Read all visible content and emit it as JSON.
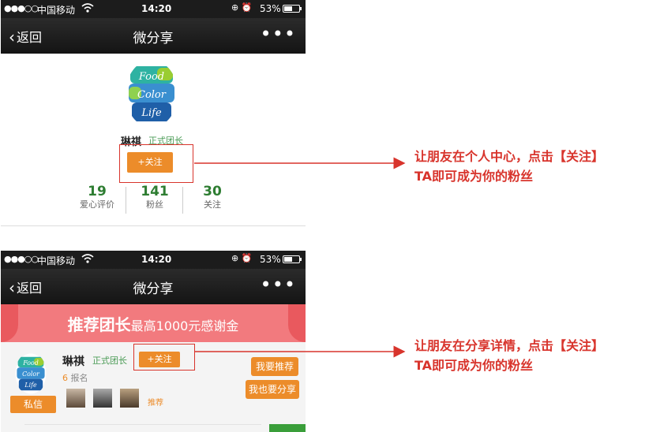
{
  "status_bar": {
    "signal": "●●●○○",
    "carrier": "中国移动",
    "wifi_icon": "wifi-icon",
    "time": "14:20",
    "icons": "⊕ ⏰",
    "battery_percent": "53%",
    "battery_level": 0.53
  },
  "nav": {
    "back_label": "返回",
    "title": "微分享",
    "more": "•••"
  },
  "profile": {
    "logo_text": [
      "Food",
      "Color",
      "Life"
    ],
    "name": "琳祺",
    "role": "正式团长",
    "follow_label": "+关注",
    "stats": [
      {
        "value": "19",
        "label": "爱心评价"
      },
      {
        "value": "141",
        "label": "粉丝"
      },
      {
        "value": "30",
        "label": "关注"
      }
    ]
  },
  "share": {
    "banner_main": "推荐团长",
    "banner_sub": "最高1000元感谢金",
    "name": "琳祺",
    "role": "正式团长",
    "follow_label": "+关注",
    "signup_count": "6",
    "signup_label": "报名",
    "dm_label": "私信",
    "recommend_small": "推荐",
    "btn_recommend": "我要推荐",
    "btn_share": "我也要分享"
  },
  "annotations": {
    "note1": [
      "让朋友在个人中心，点击【关注】",
      "TA即可成为你的粉丝"
    ],
    "note2": [
      "让朋友在分享详情，点击【关注】",
      "TA即可成为你的粉丝"
    ]
  },
  "colors": {
    "accent": "#ec8c2a",
    "annotation": "#d8342c",
    "stat_number": "#2e7d32",
    "banner": "#f27a7e"
  }
}
